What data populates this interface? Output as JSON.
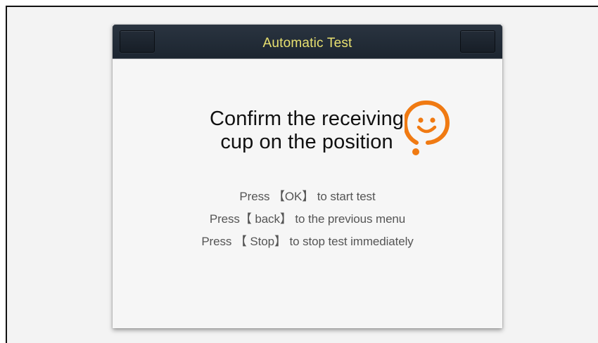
{
  "dialog": {
    "title": "Automatic Test",
    "headline_line1": "Confirm the receiving",
    "headline_line2": "cup on the position",
    "instructions": [
      "Press 【OK】 to start test",
      "Press【 back】 to the previous menu",
      "Press 【 Stop】 to stop test immediately"
    ]
  },
  "colors": {
    "title_text": "#e8e070",
    "titlebar": "#1c2530",
    "mascot_orange": "#f07a12"
  },
  "icons": {
    "mascot": "smiley-question-mark-icon"
  }
}
